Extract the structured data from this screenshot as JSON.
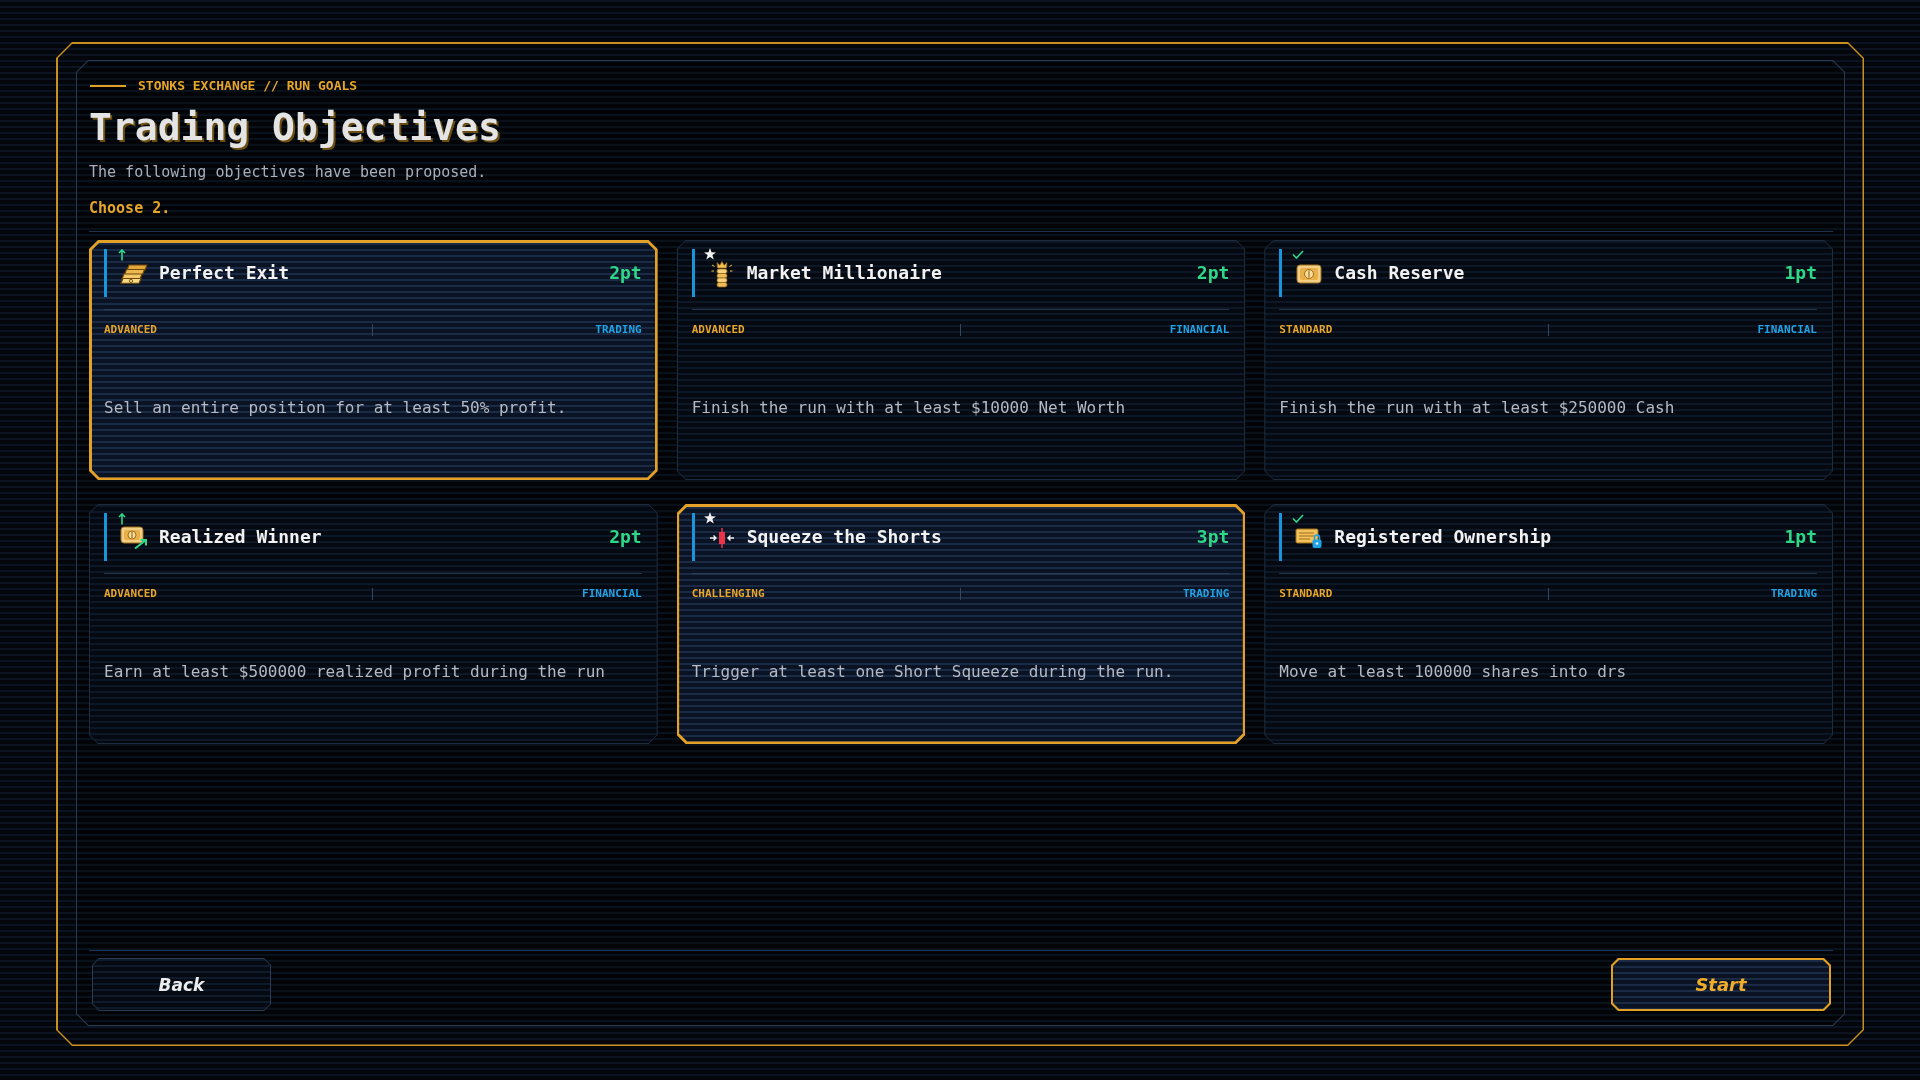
{
  "breadcrumb": "STONKS EXCHANGE // RUN GOALS",
  "title": "Trading Objectives",
  "subtitle": "The following objectives have been proposed.",
  "instruction": "Choose 2.",
  "objectives": [
    {
      "title": "Perfect Exit",
      "points": "2pt",
      "difficulty": "ADVANCED",
      "category": "TRADING",
      "description": "Sell an entire position for at least 50% profit.",
      "selected": true
    },
    {
      "title": "Market Millionaire",
      "points": "2pt",
      "difficulty": "ADVANCED",
      "category": "FINANCIAL",
      "description": "Finish the run with at least $10000 Net Worth",
      "selected": false
    },
    {
      "title": "Cash Reserve",
      "points": "1pt",
      "difficulty": "STANDARD",
      "category": "FINANCIAL",
      "description": "Finish the run with at least $250000 Cash",
      "selected": false
    },
    {
      "title": "Realized Winner",
      "points": "2pt",
      "difficulty": "ADVANCED",
      "category": "FINANCIAL",
      "description": "Earn at least $500000 realized profit during the run",
      "selected": false
    },
    {
      "title": "Squeeze the Shorts",
      "points": "3pt",
      "difficulty": "CHALLENGING",
      "category": "TRADING",
      "description": "Trigger at least one Short Squeeze during the run.",
      "selected": true
    },
    {
      "title": "Registered Ownership",
      "points": "1pt",
      "difficulty": "STANDARD",
      "category": "TRADING",
      "description": "Move at least 100000 shares into drs",
      "selected": false
    }
  ],
  "footer": {
    "back_button": "Back",
    "start_button": "Start"
  }
}
